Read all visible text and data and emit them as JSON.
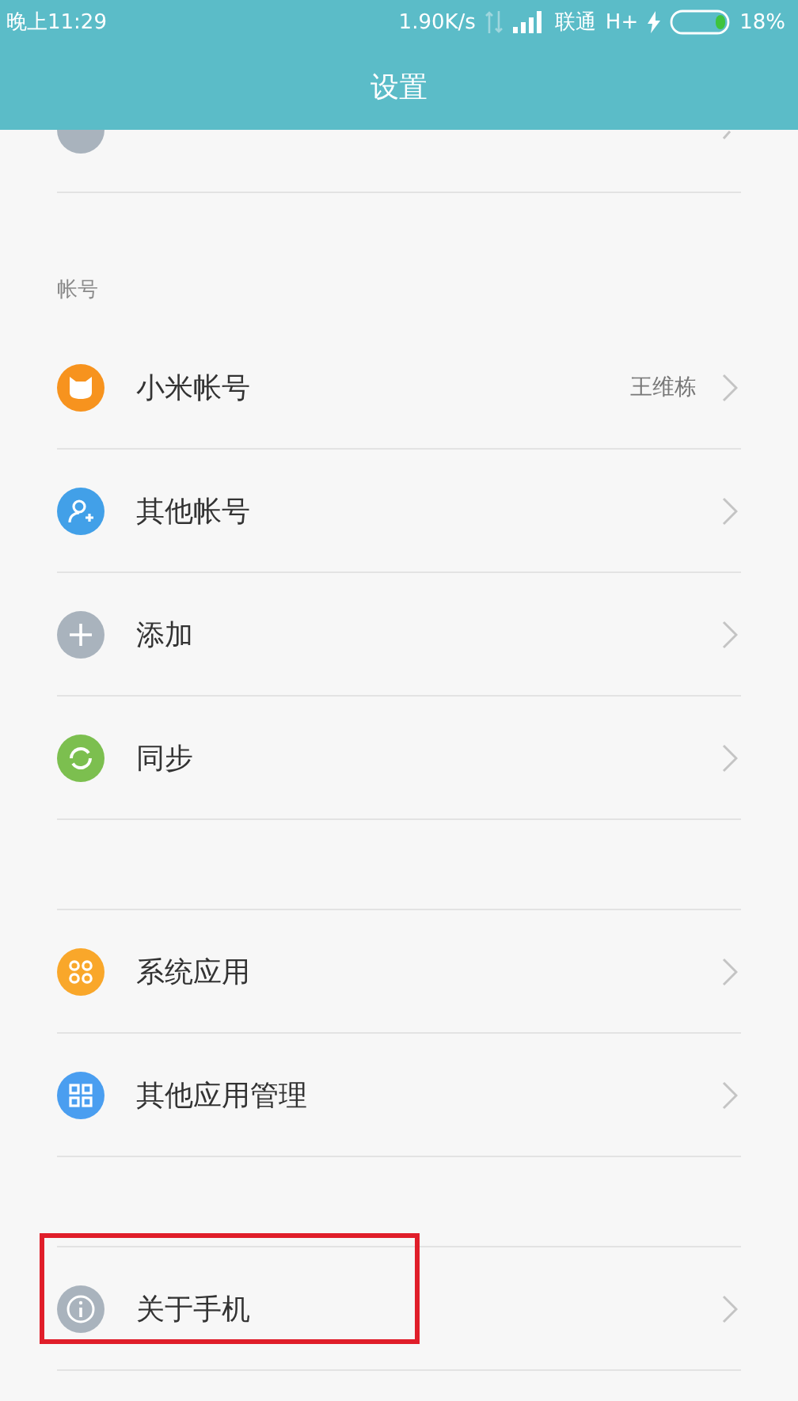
{
  "status_bar": {
    "time": "晚上11:29",
    "speed": "1.90K/s",
    "carrier": "联通",
    "network": "H+",
    "battery": "18%"
  },
  "title": "设置",
  "sections": [
    {
      "header": "帐号",
      "items": [
        {
          "kind": "mi",
          "color": "#f7931e",
          "label": "小米帐号",
          "value": "王维栋",
          "highlighted": false
        },
        {
          "kind": "person",
          "color": "#42a0e8",
          "label": "其他帐号",
          "highlighted": false
        },
        {
          "kind": "plus",
          "color": "#a9b3bd",
          "label": "添加",
          "highlighted": false
        },
        {
          "kind": "sync",
          "color": "#7cbf4f",
          "label": "同步",
          "highlighted": false
        }
      ]
    },
    {
      "items": [
        {
          "kind": "circles",
          "color": "#f9a72a",
          "label": "系统应用",
          "highlighted": false
        },
        {
          "kind": "grid",
          "color": "#4a9ef0",
          "label": "其他应用管理",
          "highlighted": false
        }
      ]
    },
    {
      "items": [
        {
          "kind": "info",
          "color": "#a9b3bd",
          "label": "关于手机",
          "highlighted": true
        }
      ]
    }
  ]
}
